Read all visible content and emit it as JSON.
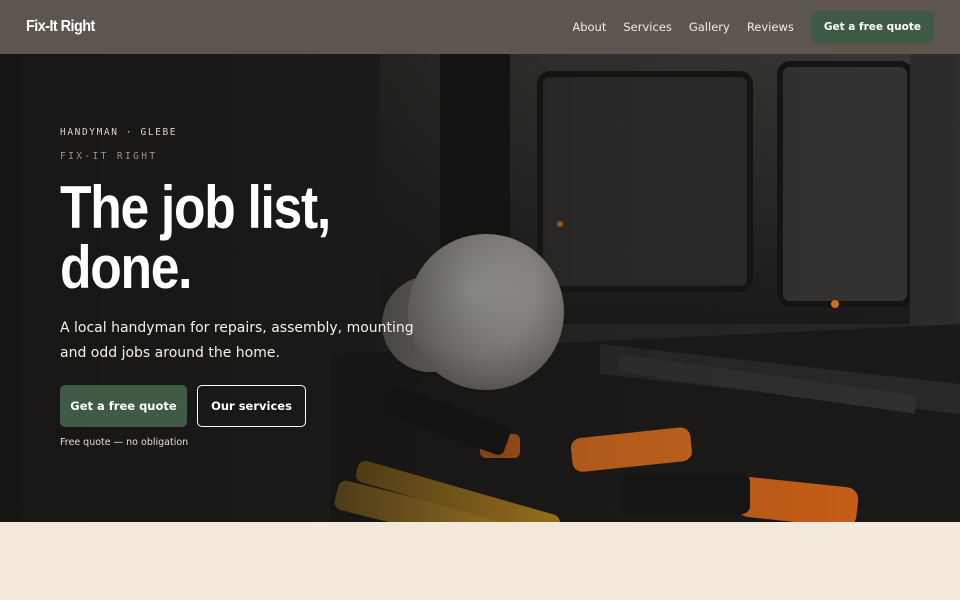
{
  "nav": {
    "brand": "Fix-It Right",
    "links": [
      "About",
      "Services",
      "Gallery",
      "Reviews"
    ],
    "cta": "Get a free quote"
  },
  "hero": {
    "eyebrow": "HANDYMAN · GLEBE",
    "eyebrow_secondary": "FIX-IT RIGHT",
    "headline_line1": "The job list,",
    "headline_line2": "done.",
    "subtext": "A local handyman for repairs, assembly, mounting and odd jobs around the home.",
    "primary_button": "Get a free quote",
    "secondary_button": "Our services",
    "note": "Free quote — no obligation",
    "photo_icon": "toolbox-photo"
  },
  "colors": {
    "nav_bg": "#5d564e",
    "accent_green": "#3f5a45",
    "page_bg": "#f2e9dc",
    "hero_dark": "#1f1d1b",
    "tool_orange": "#e0701e",
    "tool_yellow": "#d9a22a"
  }
}
